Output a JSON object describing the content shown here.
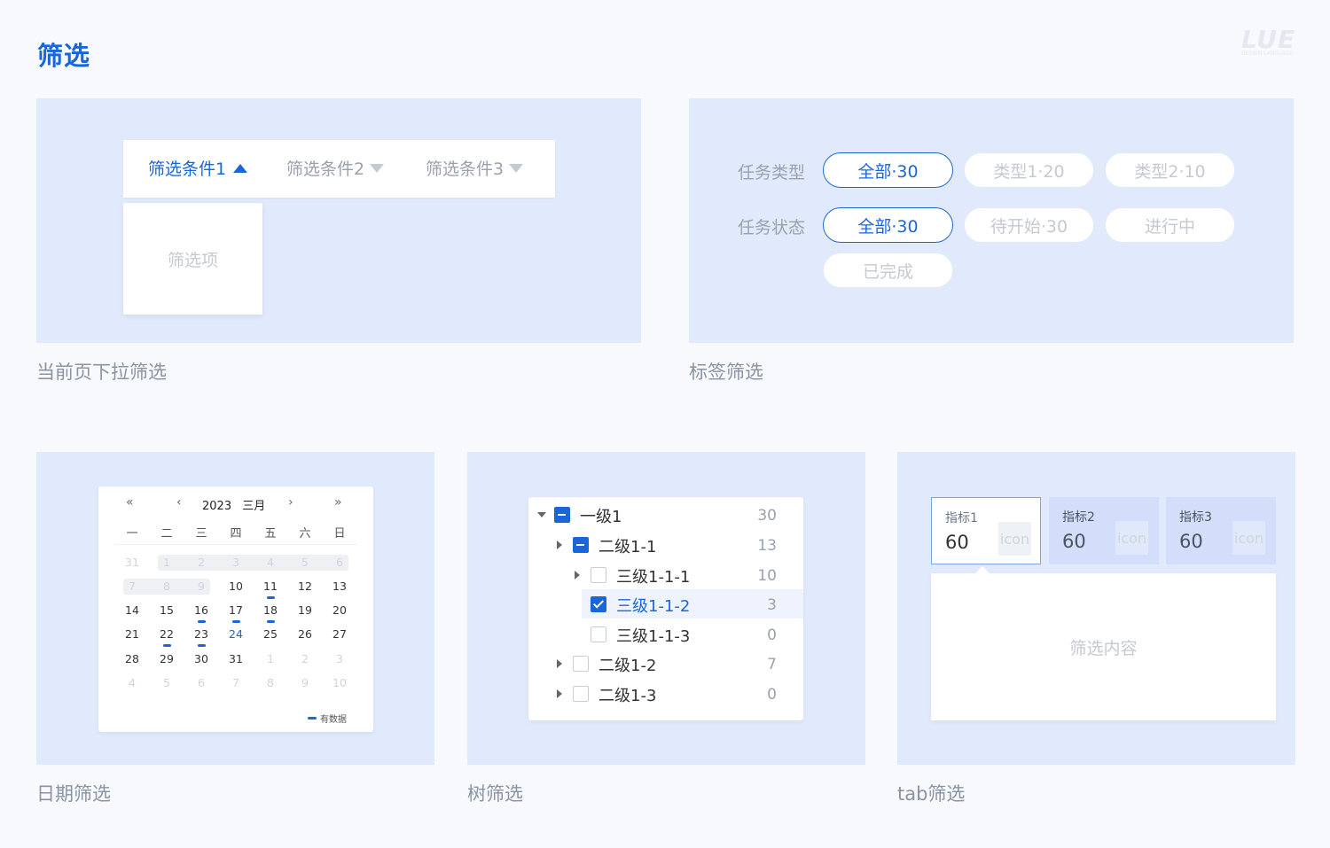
{
  "page": {
    "title": "筛选",
    "logo": "LUE",
    "logo_sub": "DESIGN LANGUAGE"
  },
  "dropdown_panel": {
    "caption": "当前页下拉筛选",
    "filters": [
      {
        "label": "筛选条件1",
        "active": true
      },
      {
        "label": "筛选条件2",
        "active": false
      },
      {
        "label": "筛选条件3",
        "active": false
      }
    ],
    "dropdown_item": "筛选项"
  },
  "tag_panel": {
    "caption": "标签筛选",
    "rows": [
      {
        "label": "任务类型",
        "tags": [
          "全部·30",
          "类型1·20",
          "类型2·10"
        ]
      },
      {
        "label": "任务状态",
        "tags": [
          "全部·30",
          "待开始·30",
          "进行中"
        ]
      }
    ],
    "extra_tag": "已完成"
  },
  "date_panel": {
    "caption": "日期筛选",
    "nav": {
      "prev_year": "«",
      "prev_month": "‹",
      "next_month": "›",
      "next_year": "»"
    },
    "year": "2023",
    "month": "三月",
    "weekdays": [
      "一",
      "二",
      "三",
      "四",
      "五",
      "六",
      "日"
    ],
    "weeks": [
      [
        "31",
        "1",
        "2",
        "3",
        "4",
        "5",
        "6"
      ],
      [
        "7",
        "8",
        "9",
        "10",
        "11",
        "12",
        "13"
      ],
      [
        "14",
        "15",
        "16",
        "17",
        "18",
        "19",
        "20"
      ],
      [
        "21",
        "22",
        "23",
        "24",
        "25",
        "26",
        "27"
      ],
      [
        "28",
        "29",
        "30",
        "31",
        "1",
        "2",
        "3"
      ],
      [
        "4",
        "5",
        "6",
        "7",
        "8",
        "9",
        "10"
      ]
    ],
    "legend": "有数据"
  },
  "tree_panel": {
    "caption": "树筛选",
    "nodes": [
      {
        "label": "一级1",
        "count": "30"
      },
      {
        "label": "二级1-1",
        "count": "13"
      },
      {
        "label": "三级1-1-1",
        "count": "10"
      },
      {
        "label": "三级1-1-2",
        "count": "3"
      },
      {
        "label": "三级1-1-3",
        "count": "0"
      },
      {
        "label": "二级1-2",
        "count": "7"
      },
      {
        "label": "二级1-3",
        "count": "0"
      }
    ]
  },
  "tab_panel": {
    "caption": "tab筛选",
    "metrics": [
      {
        "label": "指标1",
        "value": "60",
        "icon": "icon"
      },
      {
        "label": "指标2",
        "value": "60",
        "icon": "icon"
      },
      {
        "label": "指标3",
        "value": "60",
        "icon": "icon"
      }
    ],
    "content": "筛选内容"
  },
  "colors": {
    "accent": "#1a66d9",
    "panel_bg": "#e1eafc",
    "page_bg": "#f7f9fc"
  }
}
